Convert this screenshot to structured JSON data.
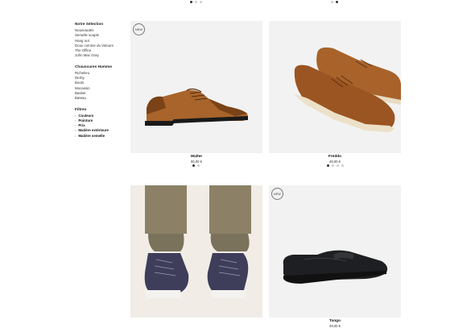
{
  "sidebar": {
    "selection": {
      "heading": "Notre Sélection",
      "items": [
        "Nouveautés",
        "Semelle souple",
        "Hang out",
        "Doux comme du Velours",
        "The Office",
        "John Mac Gray"
      ]
    },
    "men": {
      "heading": "Chaussures Homme",
      "items": [
        "Richelieu",
        "Derby",
        "Boots",
        "Mocassin",
        "Basket",
        "Bateau"
      ]
    },
    "filters": {
      "heading": "Filtres",
      "items": [
        "Couleurs",
        "Pointure",
        "Prix",
        "Matière extérieure",
        "Matière semelle"
      ]
    }
  },
  "products": [
    {
      "name": "Walter",
      "price": "90,00 €",
      "badge": "NEW",
      "image_icon": "brown-oxford-shoe-icon"
    },
    {
      "name": "Freddo",
      "price": "49,00 €",
      "badge": "",
      "image_icon": "tan-suede-derby-shoes-icon"
    },
    {
      "name": "",
      "price": "",
      "badge": "",
      "image_icon": "navy-sneakers-worn-icon"
    },
    {
      "name": "Tango",
      "price": "49,00 €",
      "badge": "NEW",
      "image_icon": "black-loafer-icon"
    }
  ],
  "colors": {
    "card_bg": "#f2f2f2",
    "dot_active": "#333333",
    "dot_inactive": "#cfcfcf"
  }
}
